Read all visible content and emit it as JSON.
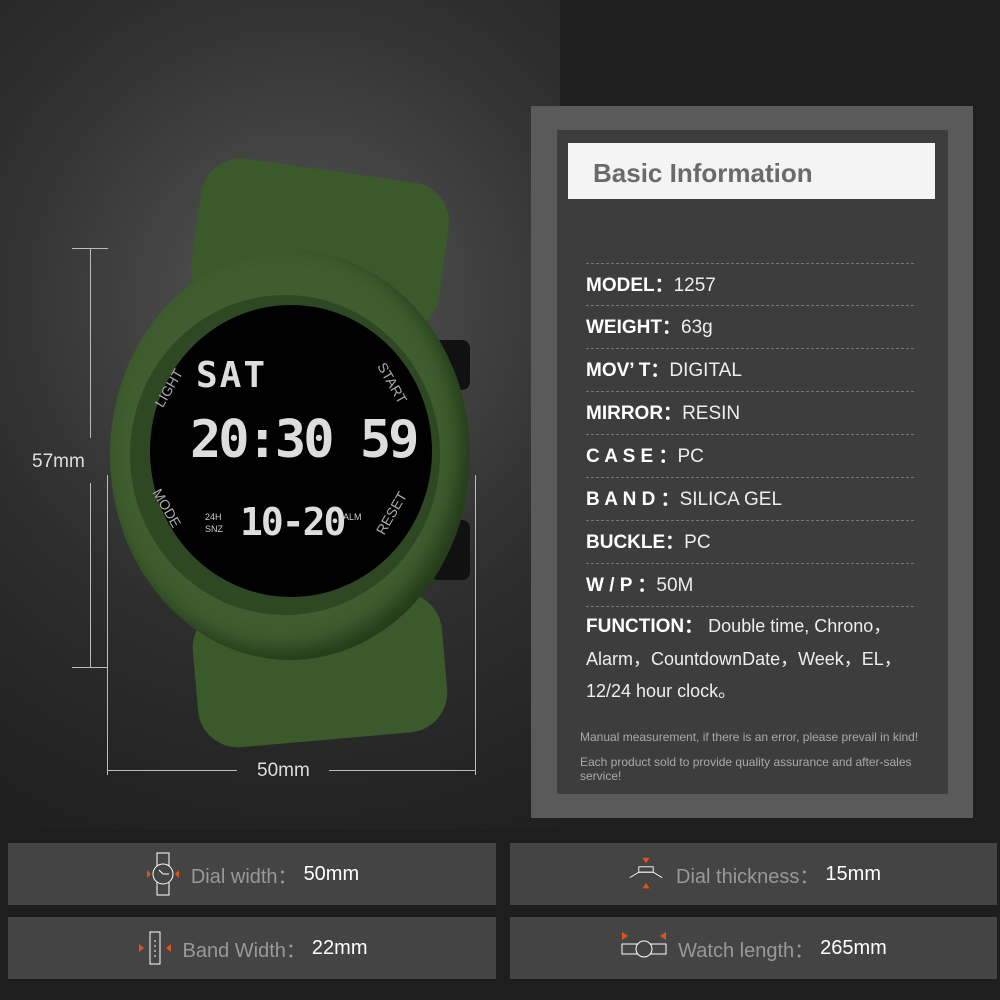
{
  "dimensions": {
    "height": "57mm",
    "width": "50mm"
  },
  "watch_face": {
    "day": "SAT",
    "time": "20:30 59",
    "date": "10-20",
    "left_top": "LIGHT",
    "left_bottom": "MODE",
    "right_top": "START",
    "right_bottom": "RESET",
    "ind_24h": "24H",
    "ind_snz": "SNZ",
    "ind_alm": "ALM",
    "strap_color": "#3b5a2c"
  },
  "info": {
    "title": "Basic Information",
    "rows": [
      {
        "label": "MODEL：",
        "value": "1257"
      },
      {
        "label": "WEIGHT：",
        "value": "63g"
      },
      {
        "label": "MOV’ T：",
        "value": "DIGITAL"
      },
      {
        "label": "MIRROR：",
        "value": "RESIN"
      },
      {
        "label": "C A S E ：",
        "value": "PC"
      },
      {
        "label": "B A N D ：",
        "value": "SILICA GEL"
      },
      {
        "label": "BUCKLE：",
        "value": "PC"
      },
      {
        "label": "W / P ：",
        "value": "50M"
      }
    ],
    "function_label": "FUNCTION：",
    "function_value": "Double time, Chrono，Alarm，CountdownDate，Week，EL，12/24 hour clock。",
    "note1": "Manual measurement, if there is an error, please prevail in kind!",
    "note2": "Each product sold to provide quality assurance and after-sales service!"
  },
  "specs": [
    {
      "icon": "dial-width-icon",
      "label": "Dial width：",
      "value": "50mm"
    },
    {
      "icon": "dial-thickness-icon",
      "label": "Dial thickness：",
      "value": "15mm"
    },
    {
      "icon": "band-width-icon",
      "label": "Band Width：",
      "value": "22mm"
    },
    {
      "icon": "watch-length-icon",
      "label": "Watch length：",
      "value": "265mm"
    }
  ],
  "accent": "#e0531f"
}
